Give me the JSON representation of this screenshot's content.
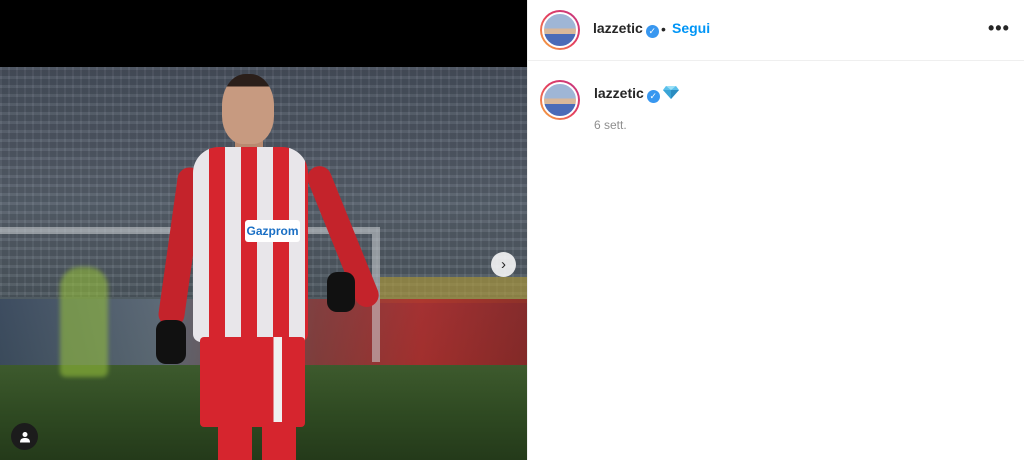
{
  "post": {
    "username": "lazzetic",
    "verified_mark": "✓",
    "separator": "•",
    "follow_label": "Segui",
    "more_label": "•••",
    "caption_emoji": "gem-emoji",
    "time_ago": "6 sett.",
    "sponsor_text": "Gazprom",
    "next_icon": "›"
  },
  "colors": {
    "accent": "#0095f6",
    "verified": "#3897f0",
    "text": "#262626",
    "muted": "#8e8e8e"
  }
}
